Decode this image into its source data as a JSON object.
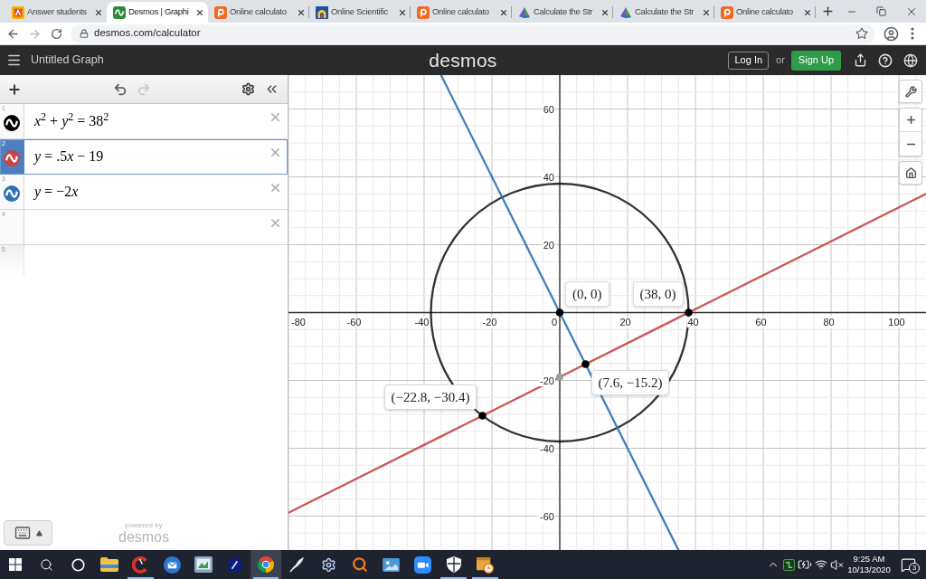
{
  "browser": {
    "tabs": [
      {
        "title": "Answer students",
        "kind": "badge",
        "selected": false
      },
      {
        "title": "Desmos | Graphi",
        "kind": "graph",
        "selected": true
      },
      {
        "title": "Online calculato",
        "kind": "square",
        "selected": false
      },
      {
        "title": "Online Scientific",
        "kind": "arch",
        "selected": false
      },
      {
        "title": "Online calculato",
        "kind": "square",
        "selected": false
      },
      {
        "title": "Calculate the Str",
        "kind": "prism",
        "selected": false
      },
      {
        "title": "Calculate the Str",
        "kind": "prism",
        "selected": false
      },
      {
        "title": "Online calculato",
        "kind": "square",
        "selected": false
      }
    ],
    "back": {
      "disabled": false
    },
    "forward": {
      "disabled": true
    },
    "url": "desmos.com/calculator"
  },
  "header": {
    "title": "Untitled Graph",
    "logo": "desmos",
    "login": "Log In",
    "or": "or",
    "signup": "Sign Up"
  },
  "toolbar": {
    "undo": {
      "disabled": false
    },
    "redo": {
      "disabled": true
    }
  },
  "expressions": [
    {
      "number": "1",
      "math": "x$^{2}$ + y$^{2}$ = 38$^{2}$",
      "color": "#000000",
      "selected": false,
      "kind": "expression"
    },
    {
      "number": "2",
      "math": "y = .5x − 19",
      "color": "#c74440",
      "selected": true,
      "kind": "expression"
    },
    {
      "number": "3",
      "math": "y = −2x",
      "color": "#2d70b3",
      "selected": false,
      "kind": "expression"
    },
    {
      "number": "4",
      "selected": false,
      "kind": "expression"
    },
    {
      "number": "5",
      "selected": false,
      "kind": "new"
    }
  ],
  "powered_by": {
    "caption": "powered by",
    "logo": "desmos"
  },
  "graph": {
    "chart_data": {
      "type": "line",
      "grid": true,
      "xlim": [
        -80,
        108
      ],
      "ylim": [
        -70,
        70
      ],
      "xticks": [
        -80,
        -60,
        -40,
        -20,
        0,
        20,
        40,
        60,
        80,
        100
      ],
      "yticks": [
        -60,
        -40,
        -20,
        20,
        40,
        60
      ],
      "x": [
        -80,
        -35,
        0,
        35,
        108
      ],
      "series": [
        {
          "color": "#c74440",
          "values": [
            -59,
            -36.5,
            -19,
            -1.5,
            35
          ]
        },
        {
          "color": "#2d70b3",
          "values": [
            null,
            70,
            0,
            -70,
            null
          ]
        }
      ],
      "annotations": [
        {
          "x": 0,
          "y": 0,
          "text": "(0, 0)"
        },
        {
          "x": 38,
          "y": 0,
          "text": "(38, 0)"
        },
        {
          "x": 7.6,
          "y": -15.2,
          "text": "(7.6, −15.2)"
        },
        {
          "x": -22.8,
          "y": -30.4,
          "text": "(−22.8, −30.4)"
        }
      ]
    }
  },
  "taskbar": {
    "items": [
      {
        "kind": "start",
        "running": false,
        "active": false
      },
      {
        "kind": "search",
        "running": false,
        "active": false
      },
      {
        "kind": "cortana",
        "running": false,
        "active": false
      },
      {
        "kind": "explorer",
        "running": false,
        "active": false
      },
      {
        "kind": "cleaner",
        "running": true,
        "active": false
      },
      {
        "kind": "mail",
        "running": false,
        "active": false
      },
      {
        "kind": "tablet",
        "running": false,
        "active": false
      },
      {
        "kind": "disc",
        "running": false,
        "active": false
      },
      {
        "kind": "chrome",
        "running": true,
        "active": true
      },
      {
        "kind": "pen",
        "running": false,
        "active": false
      },
      {
        "kind": "gear",
        "running": false,
        "active": false
      },
      {
        "kind": "magnifier",
        "running": false,
        "active": false
      },
      {
        "kind": "photo",
        "running": false,
        "active": false
      },
      {
        "kind": "zoom",
        "running": false,
        "active": false
      },
      {
        "kind": "shield",
        "running": true,
        "active": false
      },
      {
        "kind": "scheduler",
        "running": true,
        "active": false
      }
    ],
    "tray": [
      {
        "kind": "chevron"
      },
      {
        "kind": "app"
      },
      {
        "kind": "power"
      },
      {
        "kind": "wifi"
      },
      {
        "kind": "mute"
      }
    ],
    "time": "9:25 AM",
    "date": "10/13/2020",
    "notifications": "3"
  }
}
